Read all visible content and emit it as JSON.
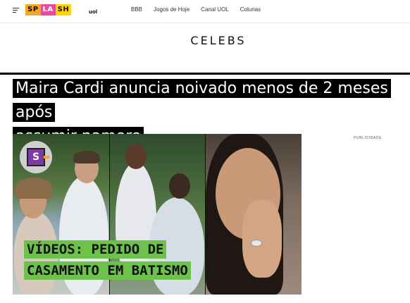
{
  "header": {
    "logo_letters": [
      "SP",
      "LA",
      "SH"
    ],
    "logo_suffix": "uol",
    "nav": [
      "BBB",
      "Jogos de Hoje",
      "Canal UOL",
      "Colunas"
    ]
  },
  "section_title": "CELEBS",
  "article": {
    "headline_line1": "Maira Cardi anuncia noivado menos de 2 meses após",
    "headline_line2": "assumir namoro"
  },
  "video": {
    "badge_letter": "S",
    "caption_line1": "VÍDEOS: PEDIDO DE",
    "caption_line2": "CASAMENTO EM BATISMO",
    "caption_color": "#6cc24a"
  },
  "ad_label": "PUBLICIDADE"
}
